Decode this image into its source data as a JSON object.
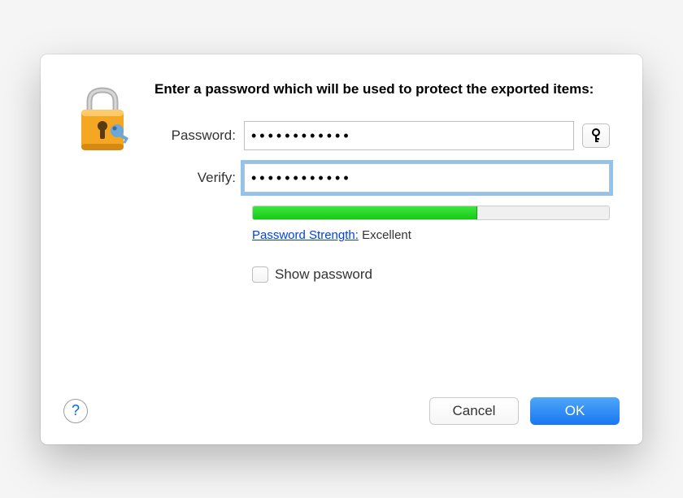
{
  "dialog": {
    "heading": "Enter a password which will be used to protect the exported items:",
    "password_label": "Password:",
    "verify_label": "Verify:",
    "password_value": "••••••••••••",
    "verify_value": "••••••••••••",
    "key_icon": "key-icon",
    "strength_link": "Password Strength:",
    "strength_value": "Excellent",
    "strength_percent": 63,
    "show_password_label": "Show password",
    "show_password_checked": false,
    "help": "?",
    "cancel": "Cancel",
    "ok": "OK"
  }
}
